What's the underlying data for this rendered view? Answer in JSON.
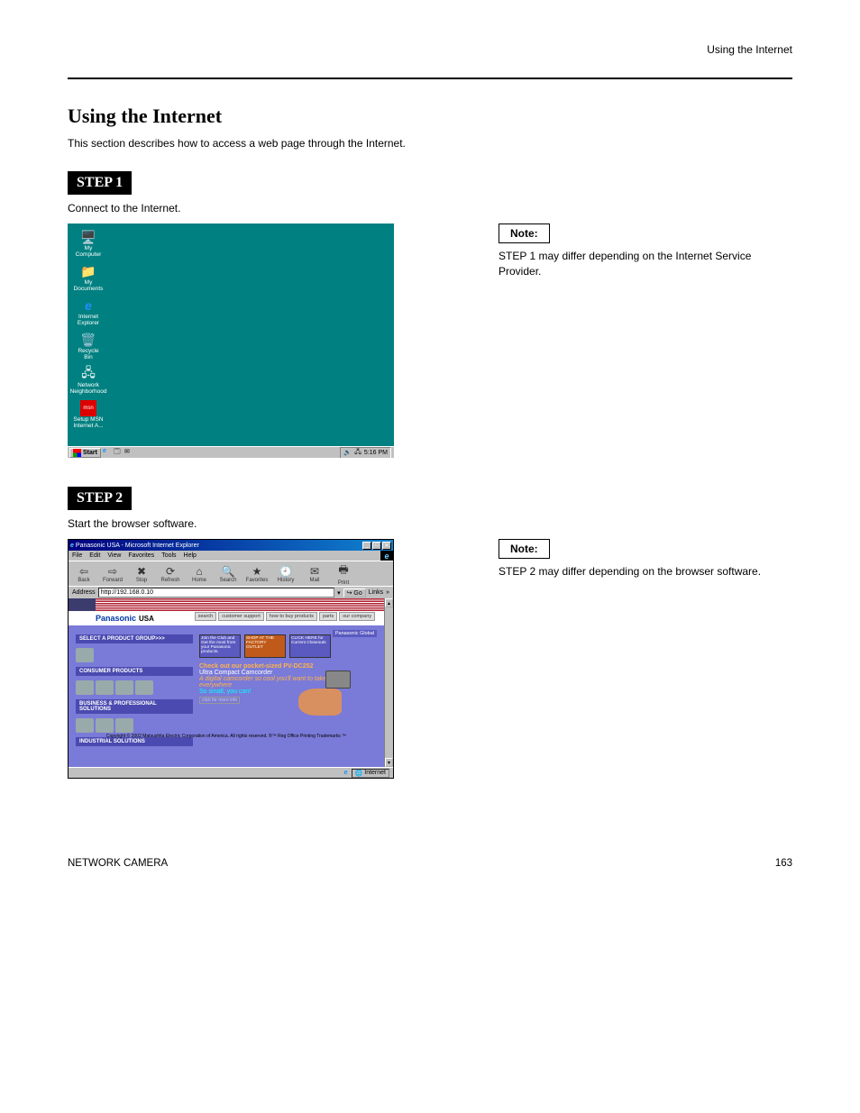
{
  "header": {
    "right": "Using the Internet"
  },
  "section": {
    "title": "Using the Internet",
    "subtitle": "This section describes how to access a web page through the Internet."
  },
  "step1": {
    "label": "STEP 1",
    "desc": "Connect to the Internet.",
    "note_label": "Note:",
    "note_text": "STEP 1 may differ depending on the Internet Service Provider."
  },
  "desktop": {
    "icons": [
      {
        "name": "my-computer-icon",
        "glyph": "🖥️",
        "label": "My Computer"
      },
      {
        "name": "my-documents-icon",
        "glyph": "📁",
        "label": "My Documents"
      },
      {
        "name": "internet-explorer-icon",
        "glyph": "e",
        "label": "Internet Explorer",
        "color": "#1e90ff"
      },
      {
        "name": "recycle-bin-icon",
        "glyph": "🗑️",
        "label": "Recycle Bin"
      },
      {
        "name": "network-neighborhood-icon",
        "glyph": "🖧",
        "label": "Network Neighborhood"
      },
      {
        "name": "setup-msn-icon",
        "glyph": "msn",
        "label": "Setup MSN Internet A...",
        "bg": "#d00"
      }
    ],
    "start": "Start",
    "clock": "5:16 PM"
  },
  "step2": {
    "label": "STEP 2",
    "desc": "Start the browser software.",
    "note_label": "Note:",
    "note_text": "STEP 2 may differ depending on the browser software."
  },
  "ie": {
    "title": "Panasonic USA - Microsoft Internet Explorer",
    "menu": [
      "File",
      "Edit",
      "View",
      "Favorites",
      "Tools",
      "Help"
    ],
    "toolbar": [
      {
        "name": "back-button",
        "glyph": "⇦",
        "label": "Back"
      },
      {
        "name": "forward-button",
        "glyph": "⇨",
        "label": "Forward"
      },
      {
        "name": "stop-button",
        "glyph": "✖",
        "label": "Stop"
      },
      {
        "name": "refresh-button",
        "glyph": "⟳",
        "label": "Refresh"
      },
      {
        "name": "home-button",
        "glyph": "⌂",
        "label": "Home"
      },
      {
        "name": "search-button",
        "glyph": "🔍",
        "label": "Search"
      },
      {
        "name": "favorites-button",
        "glyph": "★",
        "label": "Favorites"
      },
      {
        "name": "history-button",
        "glyph": "🕘",
        "label": "History"
      },
      {
        "name": "mail-button",
        "glyph": "✉",
        "label": "Mail"
      },
      {
        "name": "print-button",
        "glyph": "🖶",
        "label": "Print"
      }
    ],
    "address_label": "Address",
    "address_value": "http://192.168.0.10",
    "go": "Go",
    "links": "Links",
    "zone": "Internet"
  },
  "webpage": {
    "logo": "Panasonic",
    "logo_sub": "USA",
    "nav": [
      "search",
      "customer support",
      "how to buy products",
      "parts",
      "our company"
    ],
    "global": "Panasonic Global",
    "sections": [
      "SELECT A PRODUCT GROUP>>>",
      "CONSUMER PRODUCTS",
      "BUSINESS & PROFESSIONAL SOLUTIONS",
      "INDUSTRIAL SOLUTIONS"
    ],
    "promo1_a": "Join the Club and Get the most from your Panasonic products.",
    "promo1_b": "SHOP AT THE FACTORY OUTLET",
    "promo1_c": "CLICK HERE for Current Closeouts",
    "main_line1": "Check out our pocket-sized PV-DC252",
    "main_line2": "Ultra Compact Camcorder",
    "main_line3": "A digital camcorder so cool you'll want to take it everywhere",
    "main_line4": "So small, you can!",
    "moreinfo": "click for more info",
    "copyright": "Copyright © 2002 Matsushita Electric Corporation of America. All rights reserved. ®™ Reg Office Printing Trademarks ™"
  },
  "footer": {
    "left": "NETWORK CAMERA",
    "right": "163"
  }
}
